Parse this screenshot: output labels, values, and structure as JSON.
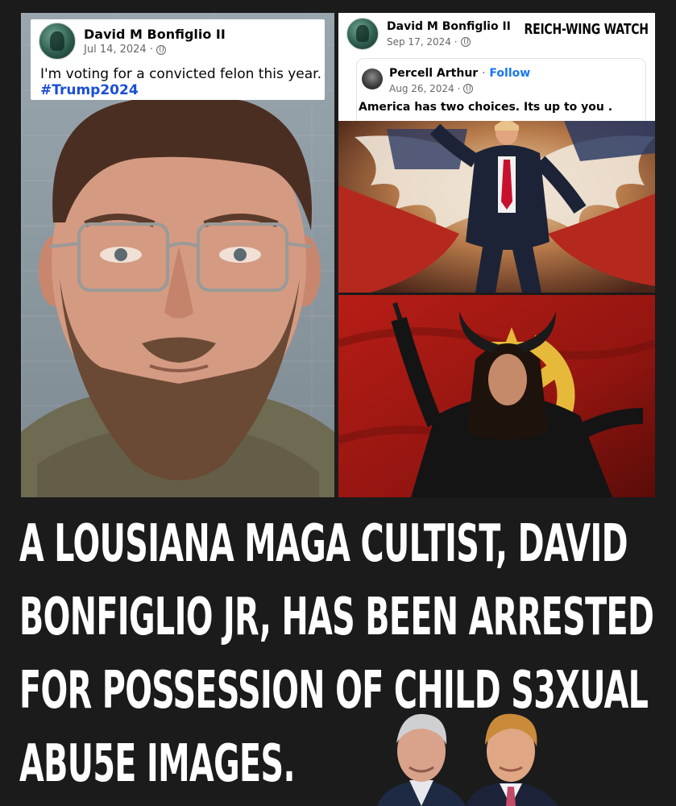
{
  "left_post": {
    "author": "David M Bonfiglio II",
    "date": "Jul 14, 2024 ·",
    "text": "I'm voting for a convicted felon this year.",
    "hashtag": "#Trump2024"
  },
  "right_post": {
    "author": "David M Bonfiglio II",
    "date": "Sep 17, 2024 ·",
    "watermark": "REICH-WING WATCH",
    "shared_post": {
      "author": "Percell Arthur",
      "separator": "·",
      "follow_label": "Follow",
      "date": "Aug 26, 2024 ·",
      "text": "America has two choices.  Its up to you ."
    }
  },
  "headline": {
    "lines": [
      "A LOUSIANA MAGA CULTIST, DAVID",
      "BONFIGLIO JR, HAS BEEN ARRESTED",
      "FOR POSSESSION OF CHILD S3XUAL",
      "ABU5E IMAGES."
    ]
  },
  "icons": {
    "privacy": "globe-icon"
  },
  "colors": {
    "background": "#1b1b1b",
    "headline": "#ffffff",
    "hashtag": "#1a4fd6",
    "follow": "#1877f2",
    "meta": "#65676b"
  }
}
